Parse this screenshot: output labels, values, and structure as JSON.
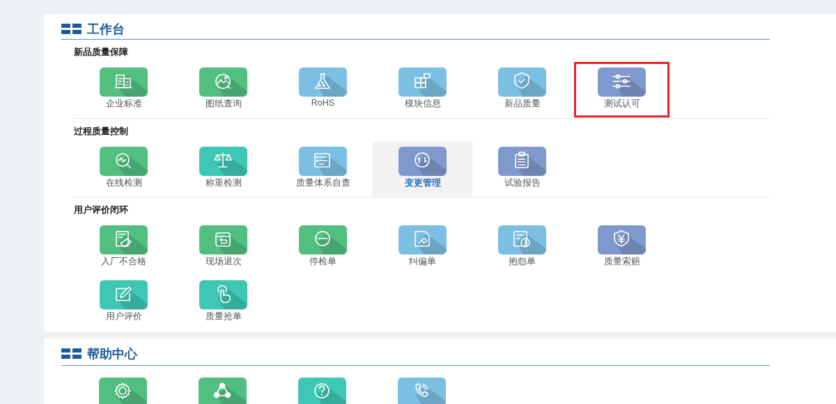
{
  "workbench": {
    "title": "工作台",
    "sections": [
      {
        "heading": "新品质量保障",
        "items": [
          {
            "label": "企业标准",
            "color": "#52be80",
            "selected": false,
            "outlined": false
          },
          {
            "label": "图纸查询",
            "color": "#52be80",
            "selected": false,
            "outlined": false
          },
          {
            "label": "RoHS",
            "color": "#7bbfe3",
            "selected": false,
            "outlined": false
          },
          {
            "label": "模块信息",
            "color": "#7bbfe3",
            "selected": false,
            "outlined": false
          },
          {
            "label": "新品质量",
            "color": "#7bbfe3",
            "selected": false,
            "outlined": false
          },
          {
            "label": "测试认可",
            "color": "#8099cc",
            "selected": false,
            "outlined": true
          }
        ]
      },
      {
        "heading": "过程质量控制",
        "items": [
          {
            "label": "在线检测",
            "color": "#52be80",
            "selected": false,
            "outlined": false
          },
          {
            "label": "称重检测",
            "color": "#3ec7b4",
            "selected": false,
            "outlined": false
          },
          {
            "label": "质量体系自查",
            "color": "#7bbfe3",
            "selected": false,
            "outlined": false
          },
          {
            "label": "变更管理",
            "color": "#8099cc",
            "selected": true,
            "outlined": false
          },
          {
            "label": "试验报告",
            "color": "#8099cc",
            "selected": false,
            "outlined": false
          }
        ]
      },
      {
        "heading": "用户评价闭环",
        "items": [
          {
            "label": "入厂不合格",
            "color": "#52be80",
            "selected": false,
            "outlined": false
          },
          {
            "label": "现场退次",
            "color": "#52be80",
            "selected": false,
            "outlined": false
          },
          {
            "label": "停检单",
            "color": "#52be80",
            "selected": false,
            "outlined": false
          },
          {
            "label": "纠偏单",
            "color": "#7bbfe3",
            "selected": false,
            "outlined": false
          },
          {
            "label": "抱怨单",
            "color": "#7bbfe3",
            "selected": false,
            "outlined": false
          },
          {
            "label": "质量索赔",
            "color": "#8099cc",
            "selected": false,
            "outlined": false
          },
          {
            "label": "用户评价",
            "color": "#3ec7b4",
            "selected": false,
            "outlined": false
          },
          {
            "label": "质量抢单",
            "color": "#3ec7b4",
            "selected": false,
            "outlined": false
          }
        ]
      }
    ]
  },
  "help_center": {
    "title": "帮助中心",
    "items": [
      {
        "color": "#52be80"
      },
      {
        "color": "#52be80"
      },
      {
        "color": "#3ec7b4"
      },
      {
        "color": "#7bbfe3"
      }
    ]
  }
}
